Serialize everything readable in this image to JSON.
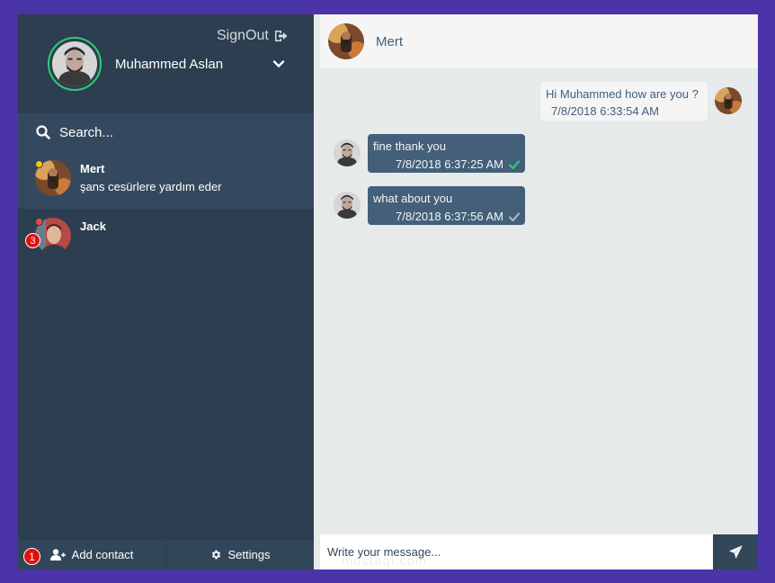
{
  "user": {
    "name": "Muhammed Aslan",
    "status_color": "#2ecc71",
    "signout_label": "SignOut"
  },
  "search": {
    "placeholder": "Search..."
  },
  "contacts": [
    {
      "name": "Mert",
      "preview": "şans cesürlere yardım eder",
      "status_color": "#f1c40f",
      "active": true
    },
    {
      "name": "Jack",
      "preview": "",
      "status_color": "#e74c3c",
      "unread": "3",
      "active": false
    }
  ],
  "sidebar_footer": {
    "notifications": "1",
    "add_contact_label": "Add contact",
    "settings_label": "Settings"
  },
  "chat": {
    "contact_name": "Mert",
    "messages": [
      {
        "direction": "sent",
        "text": "Hi Muhammed how are you ?",
        "time": "7/8/2018 6:33:54 AM"
      },
      {
        "direction": "received",
        "text": "fine thank you",
        "time": "7/8/2018 6:37:25 AM",
        "read": true
      },
      {
        "direction": "received",
        "text": "what about you",
        "time": "7/8/2018 6:37:56 AM",
        "read": false
      }
    ],
    "composer_placeholder": "Write your message...",
    "watermark": "mostaql.com"
  },
  "colors": {
    "page_bg": "#4b33a8",
    "sidebar_bg": "#2c3e50",
    "chat_bg": "#e6eaea",
    "bubble_received": "#435f7a",
    "bubble_sent": "#f5f5f5",
    "check_read": "#2ecc71",
    "check_unread": "#aab4bd",
    "badge": "#e30f0f"
  }
}
